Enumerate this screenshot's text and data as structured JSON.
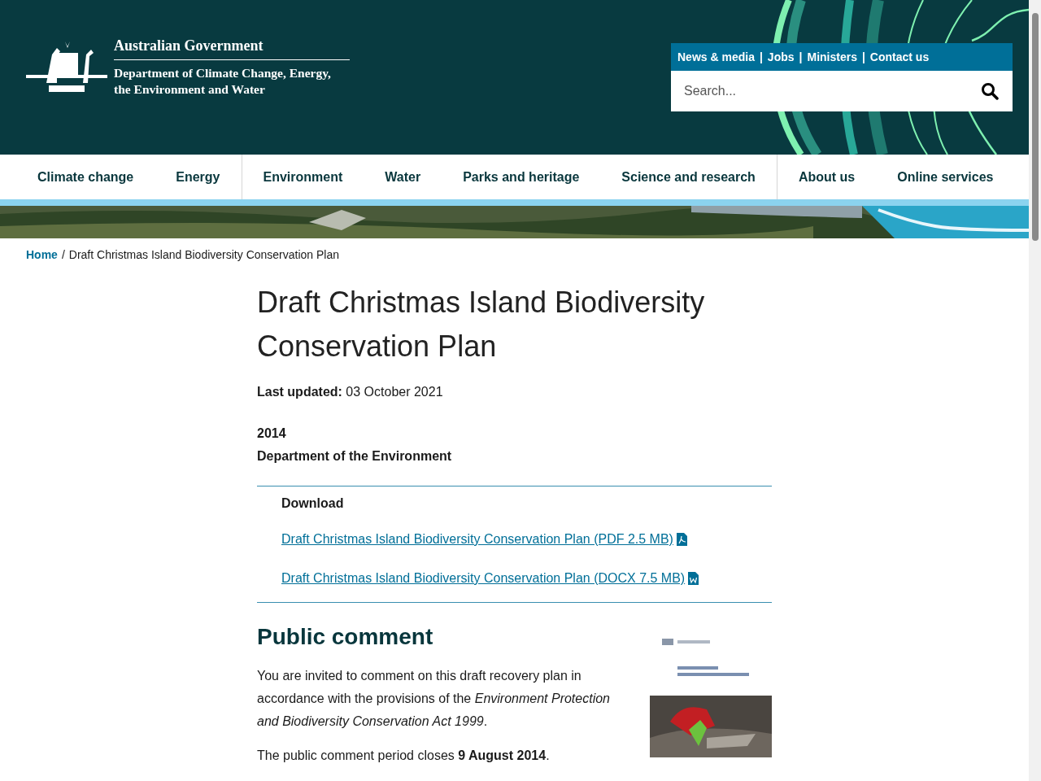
{
  "header": {
    "government": "Australian Government",
    "department": "Department of Climate Change, Energy, the Environment and Water",
    "utility_separator": "|",
    "utility_links": [
      {
        "label": "News & media"
      },
      {
        "label": "Jobs"
      },
      {
        "label": "Ministers"
      },
      {
        "label": "Contact us"
      }
    ],
    "search": {
      "placeholder": "Search..."
    }
  },
  "nav": {
    "groups": [
      [
        {
          "label": "Climate change"
        },
        {
          "label": "Energy"
        }
      ],
      [
        {
          "label": "Environment"
        },
        {
          "label": "Water"
        },
        {
          "label": "Parks and heritage"
        },
        {
          "label": "Science and research"
        }
      ],
      [
        {
          "label": "About us"
        },
        {
          "label": "Online services"
        }
      ]
    ]
  },
  "breadcrumb_separator": "/",
  "breadcrumb": [
    {
      "label": "Home",
      "kind": "link"
    },
    {
      "label": "Draft Christmas Island Biodiversity Conservation Plan",
      "kind": "current"
    }
  ],
  "page": {
    "title": "Draft Christmas Island Biodiversity Conservation Plan",
    "last_updated_label": "Last updated:",
    "last_updated": "03 October 2021",
    "year": "2014",
    "author": "Department of the Environment",
    "download": {
      "heading": "Download",
      "files": [
        {
          "label": "Draft Christmas Island Biodiversity Conservation Plan (PDF 2.5 MB)",
          "kind": "pdf"
        },
        {
          "label": "Draft Christmas Island Biodiversity Conservation Plan (DOCX 7.5 MB)",
          "kind": "docx"
        }
      ]
    },
    "public_comment": {
      "heading": "Public comment",
      "paragraphs": [
        "You are invited to comment on this draft recovery plan in accordance with the provisions of the *Environment Protection and Biodiversity Conservation Act 1999*.",
        "The public comment period closes **9 August 2014**."
      ],
      "cover": {
        "kind": "picture"
      }
    }
  }
}
